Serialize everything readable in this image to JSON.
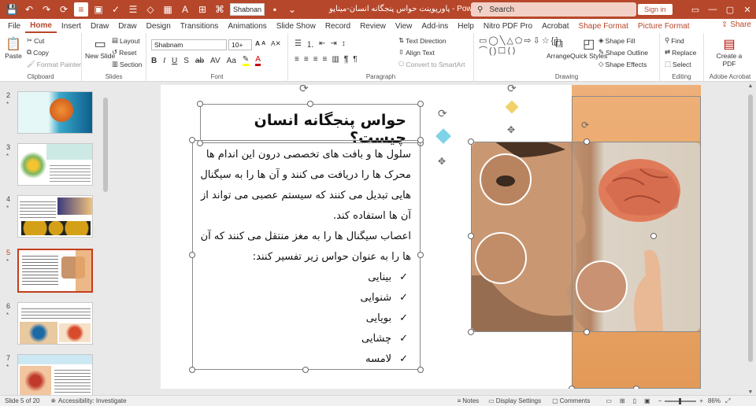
{
  "titlebar": {
    "font_box": "Shabnan",
    "doc_title": "پاورپوینت حواس پنجگانه انسان-میناپو - PowerPoint",
    "search_placeholder": "Search",
    "signin": "Sign in"
  },
  "tabs": [
    "File",
    "Home",
    "Insert",
    "Draw",
    "Draw",
    "Design",
    "Transitions",
    "Animations",
    "Slide Show",
    "Record",
    "Review",
    "View",
    "Add-ins",
    "Help",
    "Nitro PDF Pro",
    "Acrobat",
    "Shape Format",
    "Picture Format"
  ],
  "share_label": "Share",
  "ribbon": {
    "clipboard": {
      "paste": "Paste",
      "cut": "Cut",
      "copy": "Copy",
      "format_painter": "Format Painter",
      "label": "Clipboard"
    },
    "slides": {
      "new_slide": "New Slide",
      "layout": "Layout",
      "reset": "Reset",
      "section": "Section",
      "label": "Slides"
    },
    "font": {
      "name": "Shabnam",
      "size": "10+",
      "label": "Font"
    },
    "paragraph": {
      "text_direction": "Text Direction",
      "align_text": "Align Text",
      "smartart": "Convert to SmartArt",
      "label": "Paragraph"
    },
    "drawing": {
      "arrange": "Arrange",
      "quick_styles": "Quick Styles",
      "shape_fill": "Shape Fill",
      "shape_outline": "Shape Outline",
      "shape_effects": "Shape Effects",
      "label": "Drawing"
    },
    "editing": {
      "find": "Find",
      "replace": "Replace",
      "select": "Select",
      "label": "Editing"
    },
    "acrobat": {
      "create_pdf": "Create a PDF",
      "label": "Adobe Acrobat"
    }
  },
  "thumbnails": [
    {
      "num": "2",
      "star": "*"
    },
    {
      "num": "3",
      "star": "*"
    },
    {
      "num": "4",
      "star": "*"
    },
    {
      "num": "5",
      "star": "*"
    },
    {
      "num": "6",
      "star": "*"
    },
    {
      "num": "7",
      "star": "*"
    }
  ],
  "slide": {
    "title": "حواس پنجگانه انسان چیست؟",
    "para1": "سلول ها و بافت های تخصصی درون این اندام ها محرک ها را دریافت می کنند و آن ها را به سیگنال هایی تبدیل می کنند که سیستم عصبی می تواند از آن ها استفاده کند.",
    "para2": "اعصاب سیگنال ها را به مغز منتقل می کنند که آن ها را به عنوان حواس زیر تفسیر کنند:",
    "bullets": [
      "بینایی",
      "شنوایی",
      "بویایی",
      "چشایی",
      "لامسه"
    ],
    "check": "✓"
  },
  "status": {
    "slide_of": "Slide 5 of 20",
    "accessibility": "Accessibility: Investigate",
    "notes": "Notes",
    "display": "Display Settings",
    "comments": "Comments",
    "zoom": "86%"
  },
  "colors": {
    "accent": "#b7472a",
    "orange_panel": "#e8a66a"
  }
}
